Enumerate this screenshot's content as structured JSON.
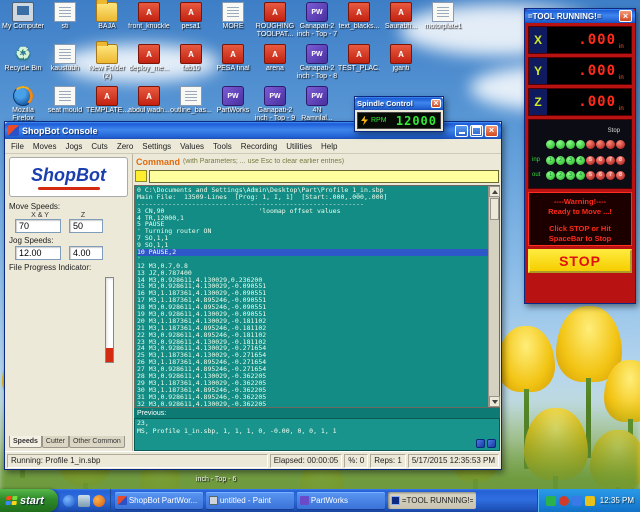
{
  "desktop": {
    "stray_label": "inch - Top - 6",
    "icon_glyphs": {
      "pw": "PW",
      "pdf": "A",
      "recycle": "♻"
    },
    "rows": [
      [
        {
          "label": "My Computer",
          "type": "computer"
        },
        {
          "label": "sti",
          "type": "doc"
        },
        {
          "label": "BAJA",
          "type": "folder"
        },
        {
          "label": "front_knuckle",
          "type": "pdf"
        },
        {
          "label": "pesa1",
          "type": "pdf"
        },
        {
          "label": "MORE",
          "type": "doc"
        },
        {
          "label": "ROUGHING TOOLPAT...",
          "type": "pdf"
        },
        {
          "label": "Ganapati-2 inch - Top - 7",
          "type": "pw"
        },
        {
          "label": "text_blacks...",
          "type": "pdf"
        },
        {
          "label": "Saurabh...",
          "type": "pdf"
        },
        {
          "label": "motorplate1",
          "type": "doc"
        }
      ],
      [
        {
          "label": "Recycle Bin",
          "type": "recycle"
        },
        {
          "label": "kaustubh",
          "type": "doc"
        },
        {
          "label": "New Folder (2)",
          "type": "folder"
        },
        {
          "label": "deploy_me...",
          "type": "pdf"
        },
        {
          "label": "fab10",
          "type": "pdf"
        },
        {
          "label": "PESA final",
          "type": "pdf"
        },
        {
          "label": "arena",
          "type": "pdf"
        },
        {
          "label": "Ganapati-2 inch - Top - 8",
          "type": "pw"
        },
        {
          "label": "TEST_PLAC...",
          "type": "pdf"
        },
        {
          "label": "jganti",
          "type": "pdf"
        }
      ],
      [
        {
          "label": "Mozilla Firefox",
          "type": "firefox"
        },
        {
          "label": "seat mould",
          "type": "doc"
        },
        {
          "label": "TEMPLATE...",
          "type": "pdf"
        },
        {
          "label": "abdul wadh...",
          "type": "pdf"
        },
        {
          "label": "outline_bas...",
          "type": "doc"
        },
        {
          "label": "PartWorks",
          "type": "pw"
        },
        {
          "label": "Ganapati-2 inch - Top - 9",
          "type": "pw"
        },
        {
          "label": "4N Ramnlal...",
          "type": "pw"
        }
      ]
    ]
  },
  "spindle": {
    "title": "Spindle Control",
    "rpm_label": "RPM",
    "rpm_value": "12000"
  },
  "shopbot": {
    "title": "ShopBot  Console",
    "logo": "ShopBot",
    "menu": [
      "File",
      "Moves",
      "Jogs",
      "Cuts",
      "Zero",
      "Settings",
      "Values",
      "Tools",
      "Recording",
      "Utilities",
      "Help"
    ],
    "left": {
      "move_speeds_label": "Move Speeds:",
      "xy_label": "X & Y",
      "z_label": "Z",
      "move_xy": "70",
      "move_z": "50",
      "jog_speeds_label": "Jog Speeds:",
      "jog_xy": "12.00",
      "jog_z": "4.00",
      "progress_label": "File Progress Indicator:",
      "tabs": [
        "Speeds",
        "Cutter",
        "Other Common"
      ]
    },
    "command": {
      "label": "Command",
      "hint": "(with Parameters; ... use Esc to clear earlier entries)",
      "input_value": ""
    },
    "console": {
      "highlight_index": 9,
      "lines": [
        "0 C:\\Documents and Settings\\Admin\\Desktop\\Part\\Profile 1_in.sbp",
        "Main File:  13509-Lines  [Prog: 1, I, 1]  [Start:.000,.000,.000]",
        "----------------------------------------------------------",
        "3 CN,90                        'loomap offset values",
        "4 TR,12000,1",
        "5 PAUSE",
        "' Turning router ON",
        "7 SO,1,1",
        "9 SO,1,1",
        "10 PAUSE,2",
        "'",
        "12 M3,0.7,0.8",
        "13 JZ,0.787400",
        "14 M3,0.928611,4.130029,0.236200",
        "15 M3,0.928611,4.130029,-0.090551",
        "16 M3,1.187361,4.130029,-0.090551",
        "17 M3,1.187361,4.895246,-0.090551",
        "18 M3,0.928611,4.895246,-0.090551",
        "19 M3,0.928611,4.130029,-0.090551",
        "20 M3,1.187361,4.130029,-0.181102",
        "21 M3,1.187361,4.895246,-0.181102",
        "22 M3,0.928611,4.895246,-0.181102",
        "23 M3,0.928611,4.130029,-0.181102",
        "24 M3,0.928611,4.130029,-0.271654",
        "25 M3,1.187361,4.130029,-0.271654",
        "26 M3,1.187361,4.895246,-0.271654",
        "27 M3,0.928611,4.895246,-0.271654",
        "28 M3,0.928611,4.130029,-0.362205",
        "29 M3,1.187361,4.130029,-0.362205",
        "30 M3,1.187361,4.895246,-0.362205",
        "31 M3,0.928611,4.895246,-0.362205",
        "32 M3,0.928611,4.130029,-0.362205"
      ],
      "previous_label": "Previous:",
      "previous_lines": [
        "23,",
        "MS, Profile 1_in.sbp, 1, 1, 1, 0, -0.00, 0, 0, 1, 1"
      ]
    },
    "status": {
      "running": "Running:  Profile 1_in.sbp",
      "elapsed": "Elapsed: 00:00:05",
      "percent": "%: 0",
      "reps": "Reps: 1",
      "datetime": "5/17/2015  12:35:53 PM"
    }
  },
  "tool_running": {
    "title": "=TOOL RUNNING!=",
    "axes": [
      {
        "label": "X",
        "value": ".000",
        "unit": "in"
      },
      {
        "label": "Y",
        "value": ".000",
        "unit": "in"
      },
      {
        "label": "Z",
        "value": ".000",
        "unit": "in"
      }
    ],
    "stop_label": "Stop",
    "inp_label": "inp",
    "out_label": "out",
    "io_numbers": [
      "1",
      "2",
      "3",
      "4",
      "5",
      "6",
      "7",
      "8"
    ],
    "warning_lines": [
      "----Warning!----",
      "Ready to Move ...!",
      "Click STOP or Hit",
      "SpaceBar to Stop"
    ],
    "stop_button": "STOP"
  },
  "taskbar": {
    "start": "start",
    "time": "12:35 PM",
    "buttons": [
      {
        "label": "ShopBot PartWor...",
        "icon": "shopbot",
        "active": false
      },
      {
        "label": "untitled - Paint",
        "icon": "paint",
        "active": false
      },
      {
        "label": "PartWorks",
        "icon": "partworks",
        "active": false
      },
      {
        "label": "=TOOL RUNNING!=",
        "icon": "tool",
        "active": true
      }
    ]
  }
}
